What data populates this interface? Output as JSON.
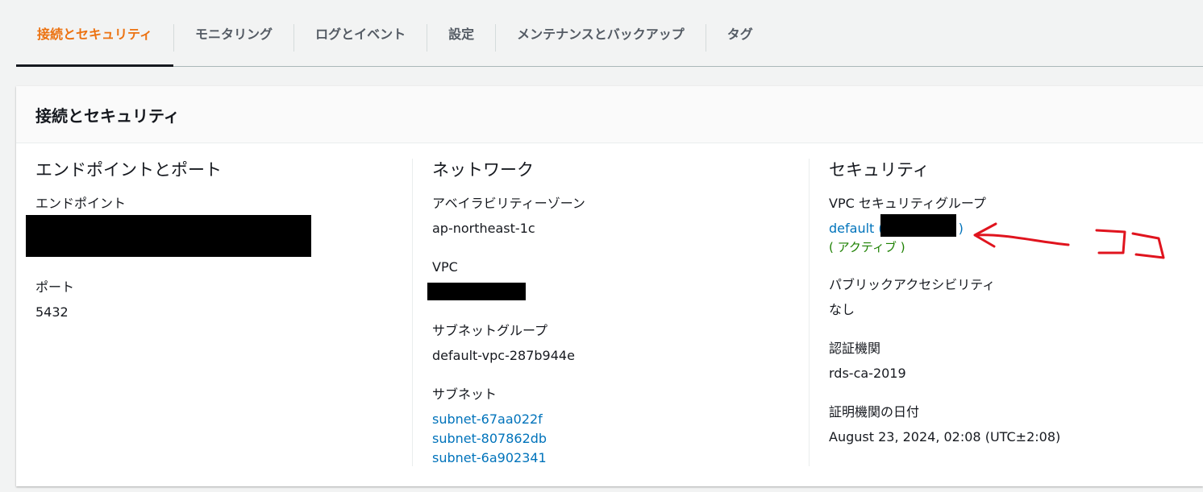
{
  "tabs": [
    {
      "label": "接続とセキュリティ",
      "active": true
    },
    {
      "label": "モニタリング",
      "active": false
    },
    {
      "label": "ログとイベント",
      "active": false
    },
    {
      "label": "設定",
      "active": false
    },
    {
      "label": "メンテナンスとバックアップ",
      "active": false
    },
    {
      "label": "タグ",
      "active": false
    }
  ],
  "panel": {
    "title": "接続とセキュリティ"
  },
  "endpoints": {
    "title": "エンドポイントとポート",
    "endpoint_label": "エンドポイント",
    "port_label": "ポート",
    "port_value": "5432"
  },
  "network": {
    "title": "ネットワーク",
    "az_label": "アベイラビリティーゾーン",
    "az_value": "ap-northeast-1c",
    "vpc_label": "VPC",
    "subnet_group_label": "サブネットグループ",
    "subnet_group_value": "default-vpc-287b944e",
    "subnets_label": "サブネット",
    "subnets": [
      "subnet-67aa022f",
      "subnet-807862db",
      "subnet-6a902341"
    ]
  },
  "security": {
    "title": "セキュリティ",
    "sg_label": "VPC セキュリティグループ",
    "sg_link_prefix": "default (",
    "sg_link_suffix": ")",
    "sg_status": "( アクティブ )",
    "public_label": "パブリックアクセシビリティ",
    "public_value": "なし",
    "ca_label": "認証機関",
    "ca_value": "rds-ca-2019",
    "ca_date_label": "証明機関の日付",
    "ca_date_value": "August 23, 2024, 02:08 (UTC±2:08)"
  },
  "annotation": {
    "text": "ココ",
    "color": "#e0141e"
  }
}
